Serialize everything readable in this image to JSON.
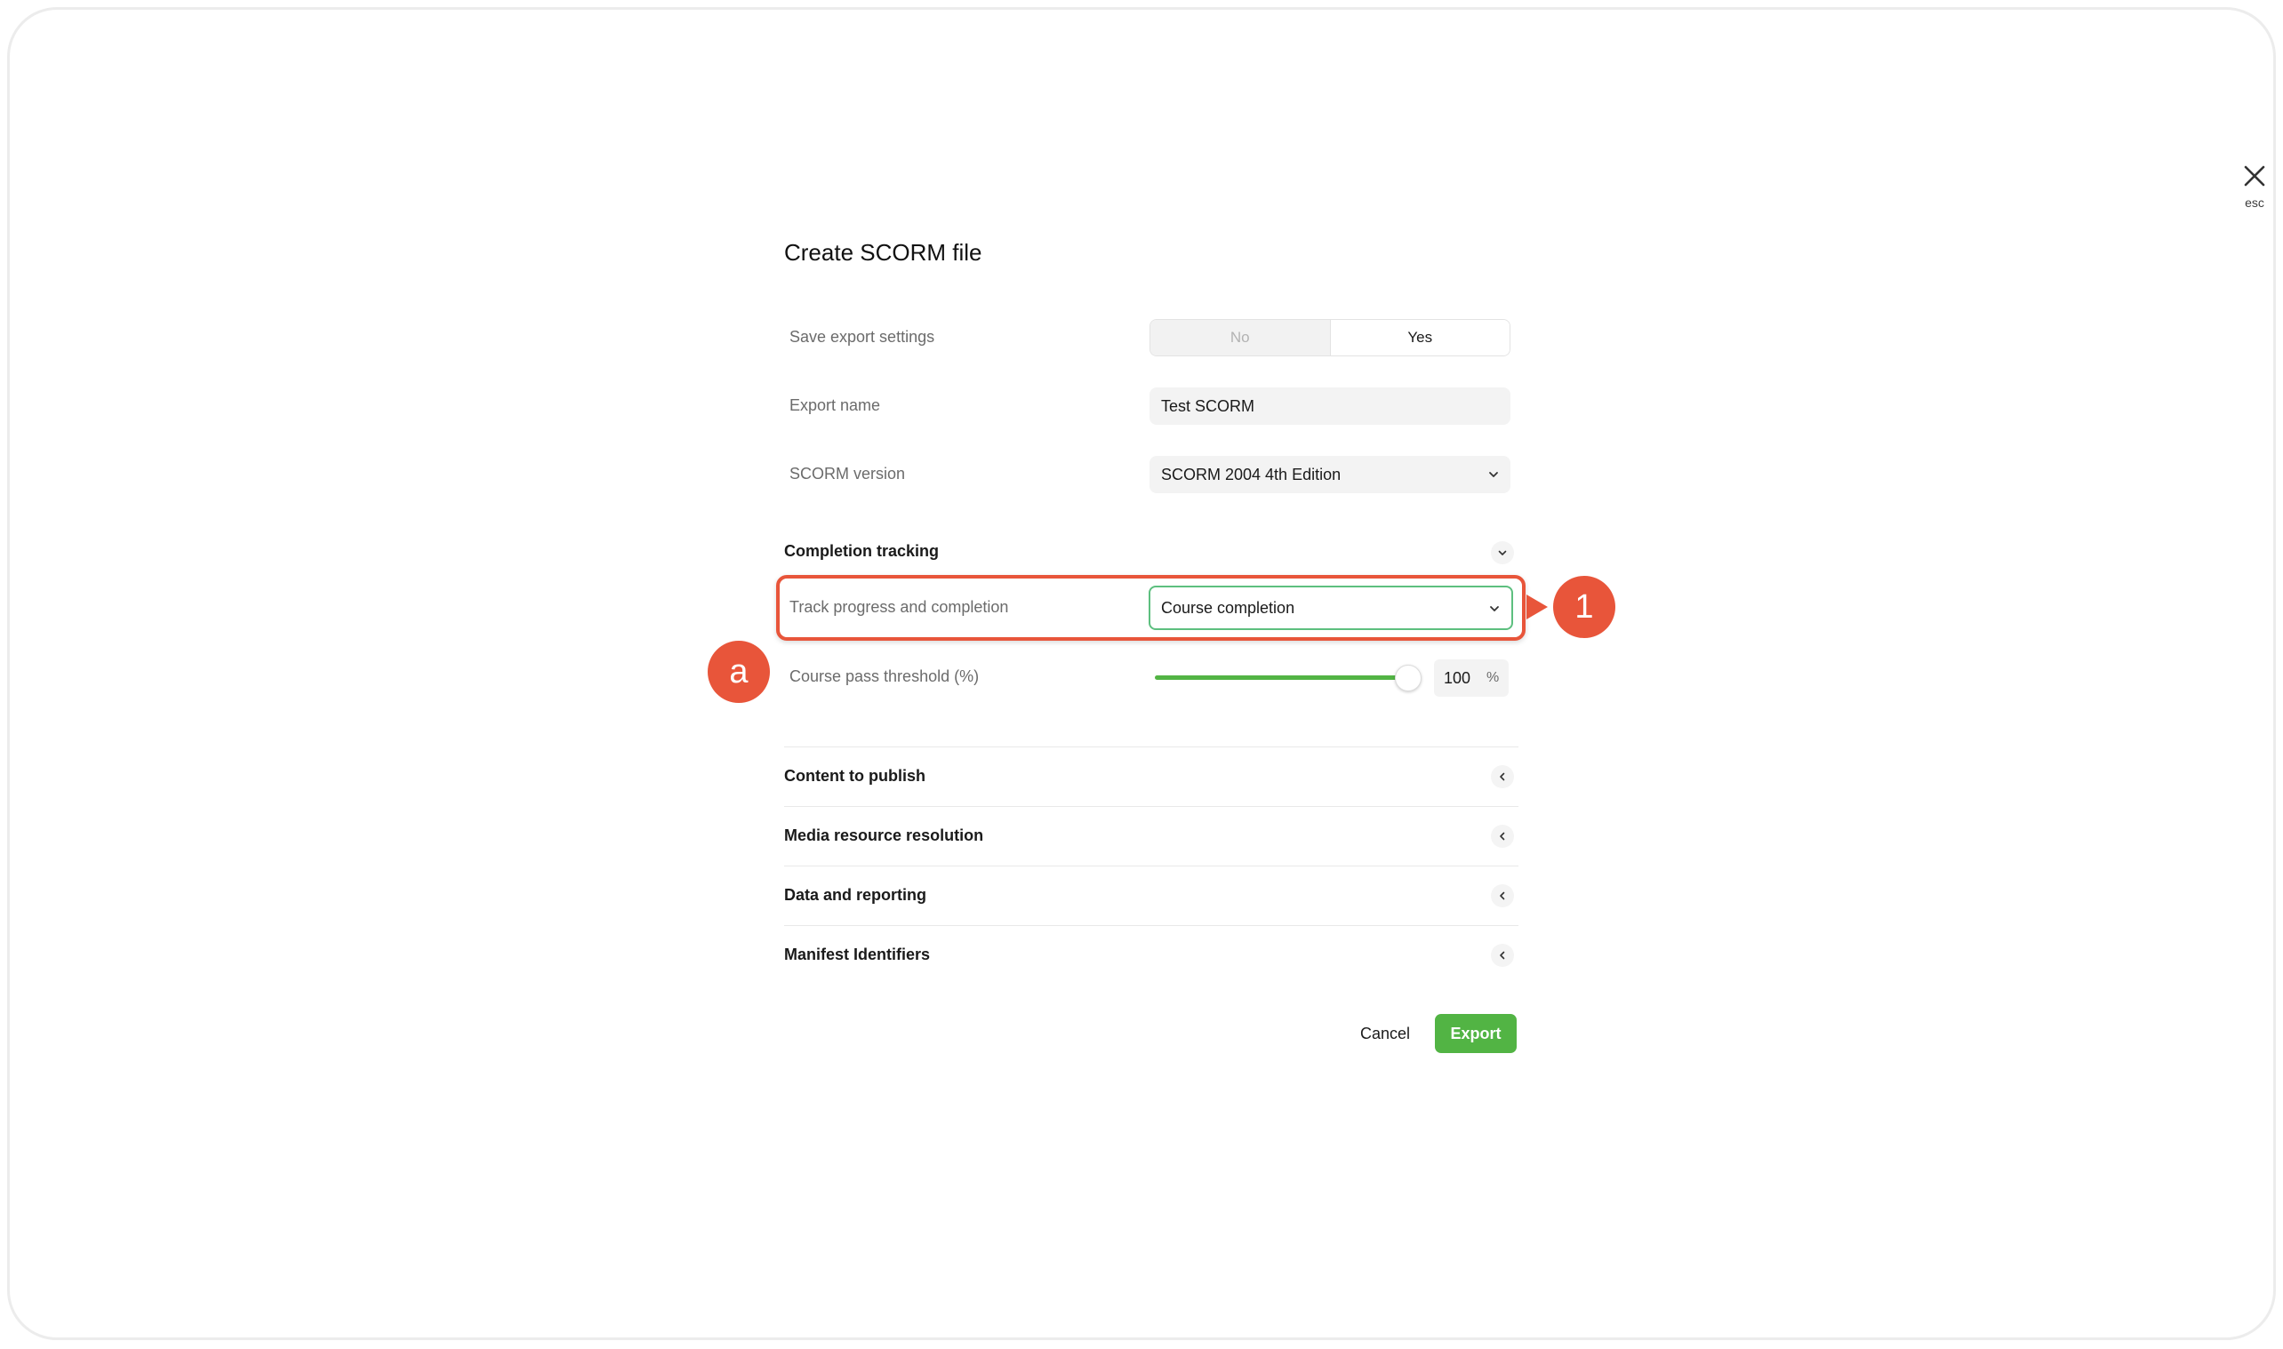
{
  "close": {
    "label": "esc"
  },
  "dialog": {
    "title": "Create SCORM file"
  },
  "save_export": {
    "label": "Save export settings",
    "options": [
      "No",
      "Yes"
    ],
    "selected": "Yes"
  },
  "export_name": {
    "label": "Export name",
    "value": "Test SCORM"
  },
  "scorm_version": {
    "label": "SCORM version",
    "value": "SCORM 2004 4th Edition"
  },
  "completion_tracking": {
    "title": "Completion tracking",
    "track": {
      "label": "Track progress and completion",
      "value": "Course completion"
    },
    "threshold": {
      "label": "Course pass threshold (%)",
      "value": "100",
      "unit": "%"
    }
  },
  "sections": [
    {
      "title": "Content to publish"
    },
    {
      "title": "Media resource resolution"
    },
    {
      "title": "Data and reporting"
    },
    {
      "title": "Manifest Identifiers"
    }
  ],
  "actions": {
    "cancel": "Cancel",
    "export": "Export"
  },
  "annotations": {
    "marker_1": "1",
    "marker_a": "a"
  },
  "colors": {
    "accent_green": "#52b444",
    "annotation_red": "#e8553a",
    "focus_green": "#5dbf7f"
  },
  "icons": {
    "close": "close-icon",
    "dropdown": "chevron-down-icon",
    "collapse": "chevron-down-icon",
    "expand": "chevron-left-icon"
  }
}
